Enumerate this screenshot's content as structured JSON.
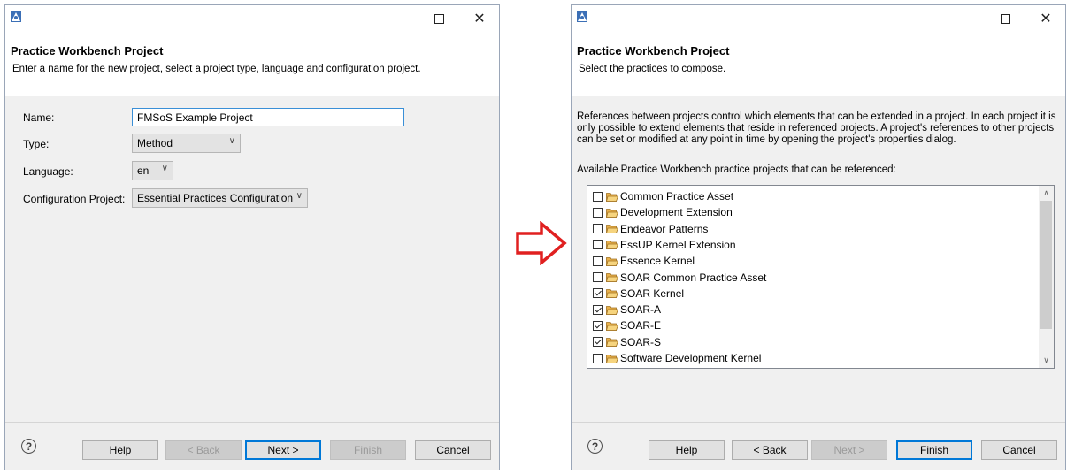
{
  "dialog1": {
    "title": "Practice Workbench Project",
    "description": "Enter a name for the new project, select a project type, language and configuration project.",
    "fields": {
      "name_label": "Name:",
      "name_value": "FMSoS Example Project",
      "type_label": "Type:",
      "type_value": "Method",
      "language_label": "Language:",
      "language_value": "en",
      "config_label": "Configuration Project:",
      "config_value": "Essential Practices Configuration"
    },
    "buttons": {
      "help": "Help",
      "back": "< Back",
      "next": "Next >",
      "finish": "Finish",
      "cancel": "Cancel"
    }
  },
  "dialog2": {
    "title": "Practice Workbench Project",
    "description": "Select the practices to compose.",
    "paragraph": "References between projects control which elements that can be extended in a project. In each project it is only possible to extend elements that reside in referenced projects. A project's references to other projects can be set or modified at any point in time by opening the project's properties dialog.",
    "list_label": "Available Practice Workbench practice projects that can be referenced:",
    "items": [
      {
        "label": "Common Practice Asset",
        "checked": false
      },
      {
        "label": "Development Extension",
        "checked": false
      },
      {
        "label": "Endeavor Patterns",
        "checked": false
      },
      {
        "label": "EssUP Kernel Extension",
        "checked": false
      },
      {
        "label": "Essence Kernel",
        "checked": false
      },
      {
        "label": "SOAR Common Practice Asset",
        "checked": false
      },
      {
        "label": "SOAR Kernel",
        "checked": true
      },
      {
        "label": "SOAR-A",
        "checked": true
      },
      {
        "label": "SOAR-E",
        "checked": true
      },
      {
        "label": "SOAR-S",
        "checked": true
      },
      {
        "label": "Software Development Kernel",
        "checked": false
      }
    ],
    "buttons": {
      "help": "Help",
      "back": "< Back",
      "next": "Next >",
      "finish": "Finish",
      "cancel": "Cancel"
    }
  },
  "colors": {
    "arrow": "#e02020",
    "accent": "#0078d7",
    "folder": "#e8b04b"
  },
  "icons": {
    "app": "workbench-app-icon",
    "help": "question-circle-icon",
    "folder": "folder-open-icon",
    "arrow": "right-arrow-icon"
  }
}
